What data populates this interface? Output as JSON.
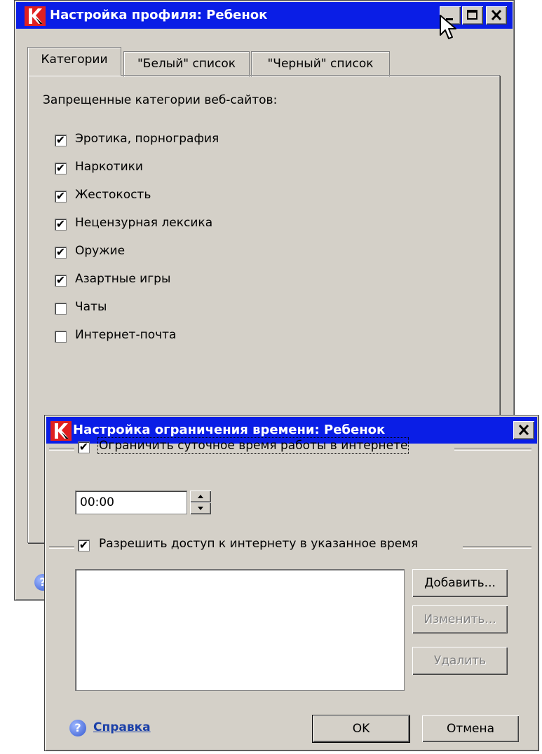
{
  "profile_window": {
    "title": "Настройка профиля: Ребенок",
    "tabs": [
      "Категории",
      "\"Белый\" список",
      "\"Черный\" список"
    ],
    "section_label": "Запрещенные категории веб-сайтов:",
    "categories": [
      {
        "label": "Эротика, порнография",
        "checked": true
      },
      {
        "label": "Наркотики",
        "checked": true
      },
      {
        "label": "Жестокость",
        "checked": true
      },
      {
        "label": "Нецензурная лексика",
        "checked": true
      },
      {
        "label": "Оружие",
        "checked": true
      },
      {
        "label": "Азартные игры",
        "checked": true
      },
      {
        "label": "Чаты",
        "checked": false
      },
      {
        "label": "Интернет-почта",
        "checked": false
      }
    ]
  },
  "time_window": {
    "title": "Настройка ограничения времени: Ребенок",
    "limit_daily": {
      "label": "Ограничить суточное время работы в интернете",
      "checked": true
    },
    "time_value": "00:00",
    "allow_access": {
      "label": "Разрешить доступ к интернету в указанное время",
      "checked": true
    },
    "buttons": {
      "add": "Добавить...",
      "edit": "Изменить...",
      "delete": "Удалить",
      "ok": "OK",
      "cancel": "Отмена"
    },
    "help": "Справка"
  },
  "colors": {
    "titlebar": "#0a1ee6",
    "face": "#d4d0c8",
    "link": "#1a3fa8",
    "logo": "#e02020"
  }
}
